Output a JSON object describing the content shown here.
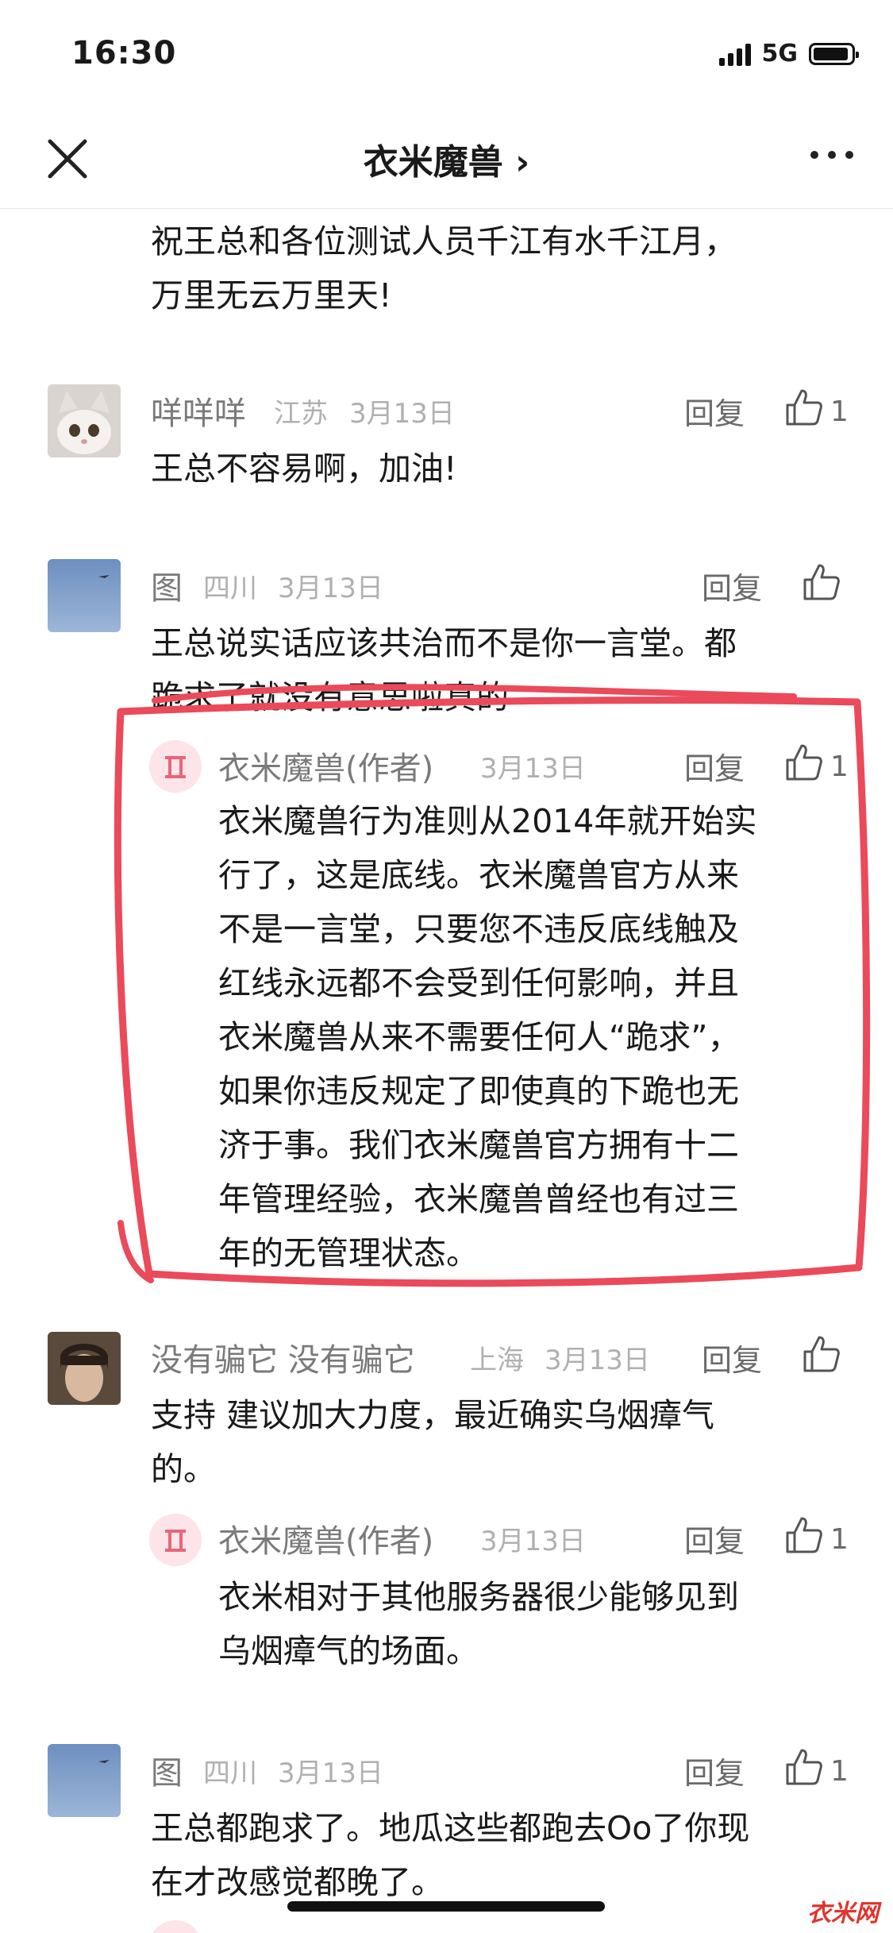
{
  "status": {
    "time": "16:30",
    "network": "5G"
  },
  "header": {
    "title": "衣米魔兽 ›"
  },
  "top_text": {
    "line1": "祝王总和各位测试人员千江有水千江月，",
    "line2": "万里无云万里天!"
  },
  "comments": [
    {
      "name": "咩咩咩",
      "location": "江苏",
      "date": "3月13日",
      "reply": "回复",
      "likes": "1",
      "text": "王总不容易啊，加油!"
    },
    {
      "name": "图",
      "location": "四川",
      "date": "3月13日",
      "reply": "回复",
      "line1": "王总说实话应该共治而不是你一言堂。都",
      "line2": "跪求了就没有意思啦真的",
      "author_reply": {
        "name": "衣米魔兽(作者)",
        "date": "3月13日",
        "reply": "回复",
        "likes": "1",
        "lines": [
          "衣米魔兽行为准则从2014年就开始实",
          "行了，这是底线。衣米魔兽官方从来",
          "不是一言堂，只要您不违反底线触及",
          "红线永远都不会受到任何影响，并且",
          "衣米魔兽从来不需要任何人“跪求”，",
          "如果你违反规定了即使真的下跪也无",
          "济于事。我们衣米魔兽官方拥有十二",
          "年管理经验，衣米魔兽曾经也有过三",
          "年的无管理状态。"
        ]
      }
    },
    {
      "name": "没有骗它 没有骗它",
      "location": "上海",
      "date": "3月13日",
      "reply": "回复",
      "line1": "支持 建议加大力度，最近确实乌烟瘴气",
      "line2": "的。",
      "author_reply": {
        "name": "衣米魔兽(作者)",
        "date": "3月13日",
        "reply": "回复",
        "likes": "1",
        "lines": [
          "衣米相对于其他服务器很少能够见到",
          "乌烟瘴气的场面。"
        ]
      }
    },
    {
      "name": "图",
      "location": "四川",
      "date": "3月13日",
      "reply": "回复",
      "likes": "1",
      "line1": "王总都跑求了。地瓜这些都跑去Oo了你现",
      "line2": "在才改感觉都晚了。"
    }
  ],
  "watermark": "衣米网"
}
